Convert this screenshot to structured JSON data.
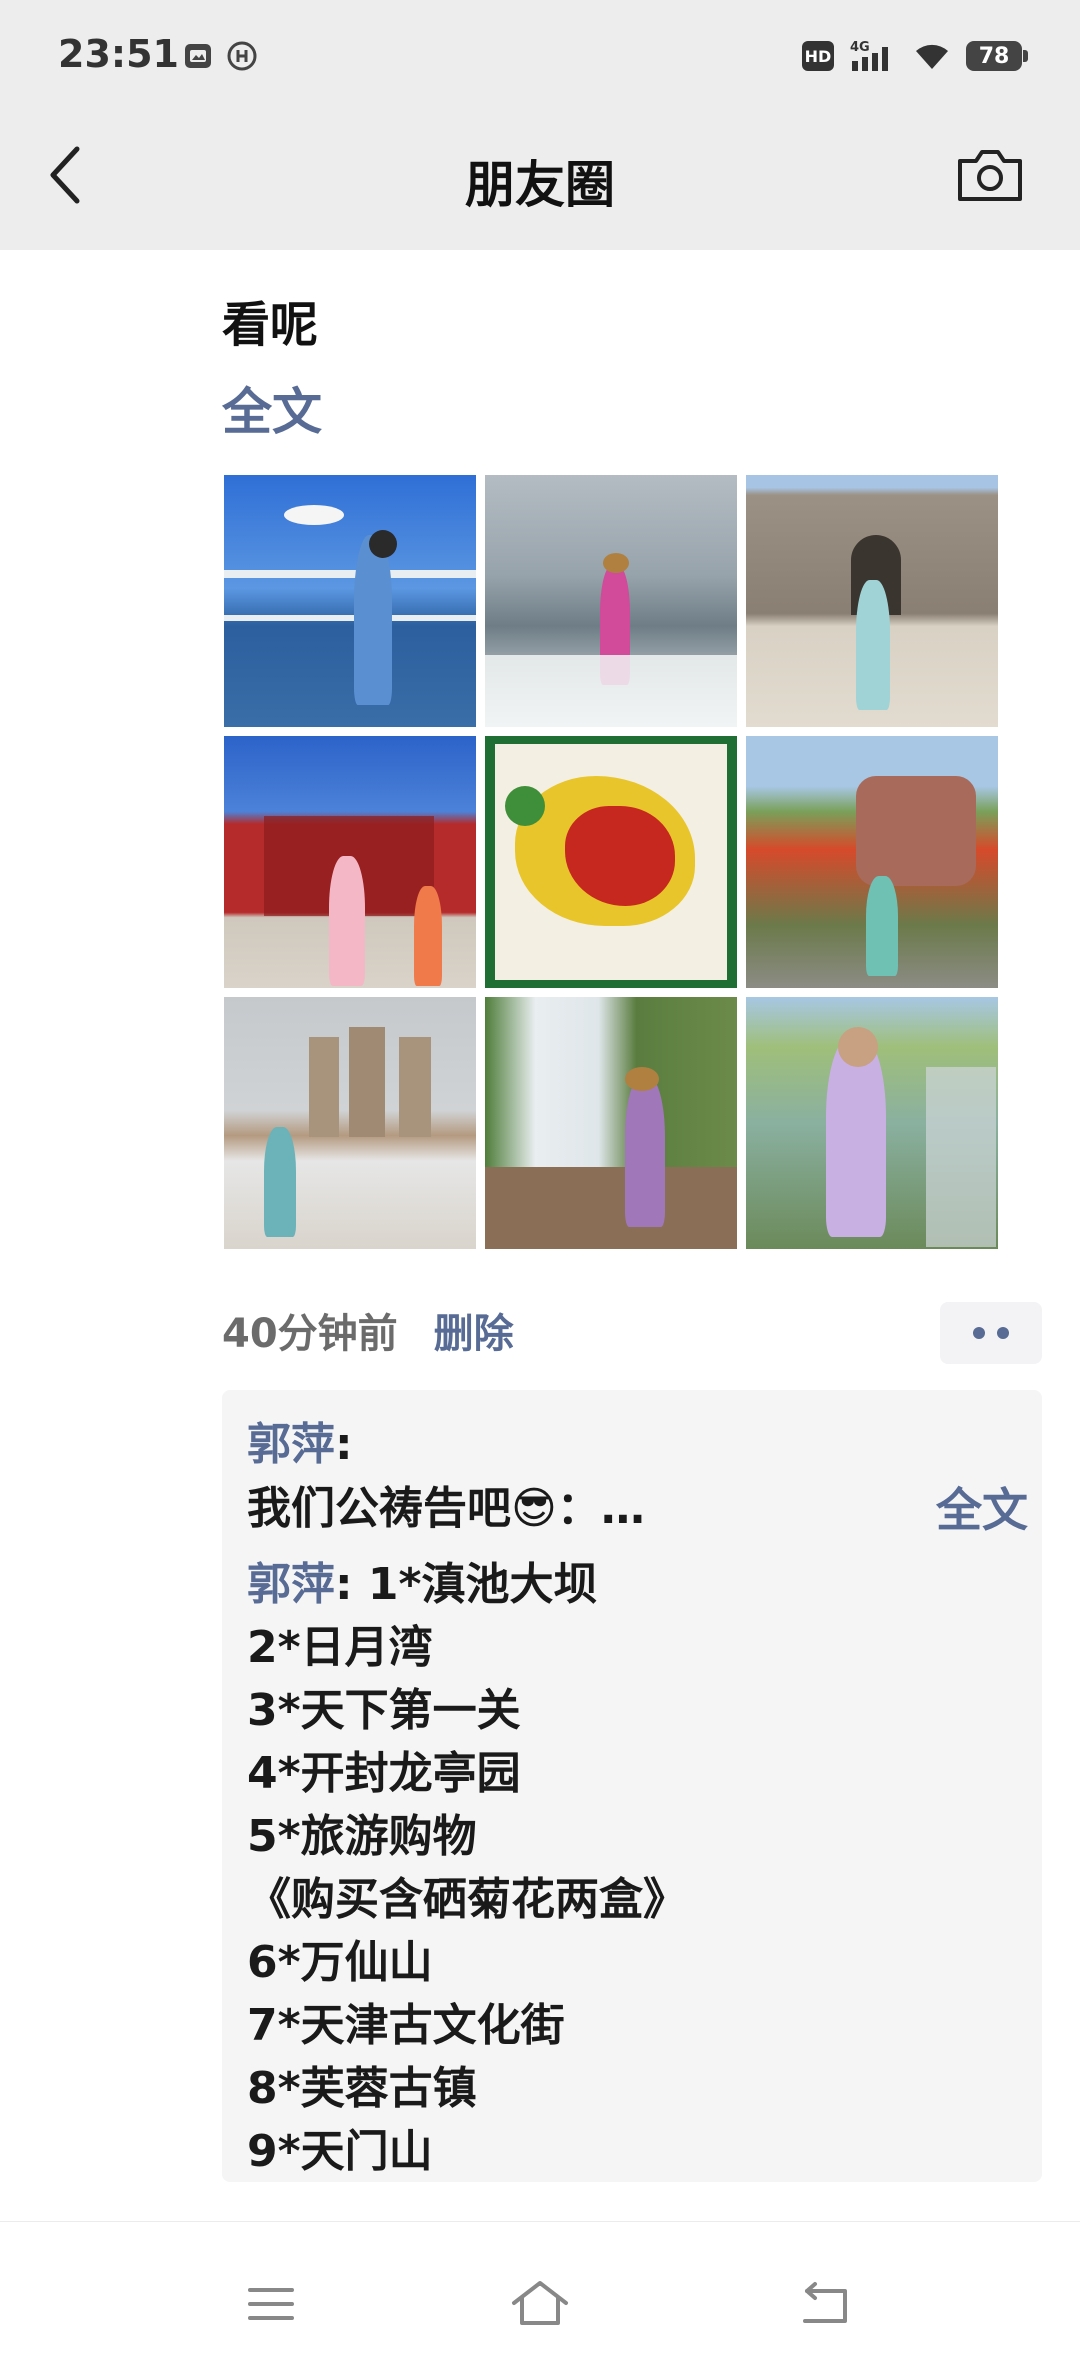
{
  "status_bar": {
    "time": "23:51",
    "left_icons": [
      "image-notification-icon",
      "info-notification-icon"
    ],
    "hd": "HD",
    "network": "4G",
    "battery": "78"
  },
  "header": {
    "title": "朋友圈",
    "back_icon": "chevron-left-icon",
    "camera_icon": "camera-icon"
  },
  "post": {
    "text": "看呢",
    "expand_label": "全文",
    "photos": [
      {
        "scene": "seagull-lake",
        "colors": [
          "#2f6fd6",
          "#6aa3e8",
          "#dfe7ef"
        ]
      },
      {
        "scene": "sea-waves",
        "colors": [
          "#a7b0b8",
          "#6e7d86",
          "#f3f3f3"
        ]
      },
      {
        "scene": "great-wall-gate",
        "colors": [
          "#a9a096",
          "#8a7f73",
          "#dcd4c6"
        ]
      },
      {
        "scene": "red-gate-park",
        "colors": [
          "#2c63c9",
          "#b52a2a",
          "#d9d3c9"
        ]
      },
      {
        "scene": "selenium-map",
        "colors": [
          "#1e6b2f",
          "#e4c020",
          "#c6271f"
        ]
      },
      {
        "scene": "wanxian-mountain",
        "colors": [
          "#d64a2b",
          "#7a5a3a",
          "#a7c7e4"
        ]
      },
      {
        "scene": "tianjin-towers",
        "colors": [
          "#c5c9cc",
          "#a99a86",
          "#e6e6e6"
        ]
      },
      {
        "scene": "waterfall",
        "colors": [
          "#4f7d3a",
          "#e9eef0",
          "#8a6e55"
        ]
      },
      {
        "scene": "tianmen-mountain",
        "colors": [
          "#9fbf7a",
          "#8ab0a0",
          "#6b8a5a"
        ]
      }
    ],
    "time_ago": "40分钟前",
    "delete_label": "删除"
  },
  "comments": {
    "line1_author": "郭萍",
    "line1_colon": ":",
    "line2": "我们公祷告吧😎：…",
    "expand_label": "全文",
    "line3_author": "郭萍",
    "line3_rest": ": 1*滇池大坝",
    "items": [
      "2*日月湾",
      "3*天下第一关",
      "4*开封龙亭园",
      "5*旅游购物",
      "《购买含硒菊花两盒》",
      "6*万仙山",
      "7*天津古文化街",
      "8*芙蓉古镇",
      "9*天门山"
    ]
  },
  "bottom_nav": {
    "icons": [
      "menu-icon",
      "home-icon",
      "back-icon"
    ]
  }
}
